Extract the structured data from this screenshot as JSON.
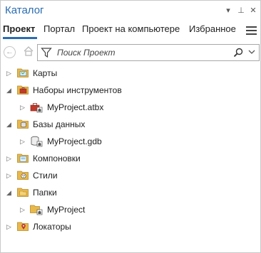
{
  "titlebar": {
    "title": "Каталог",
    "menu_btn": "▾",
    "pin_btn": "⊥",
    "close_btn": "✕"
  },
  "tabs": [
    {
      "label": "Проект"
    },
    {
      "label": "Портал"
    },
    {
      "label": "Проект на компьютере"
    },
    {
      "label": "Избранное"
    }
  ],
  "toolbar": {
    "back_glyph": "←",
    "search_placeholder": "Поиск Проект"
  },
  "tree": {
    "maps": {
      "label": "Карты",
      "expanded": false
    },
    "toolboxes": {
      "label": "Наборы инструментов",
      "expanded": true
    },
    "toolbox_item": {
      "label": "MyProject.atbx"
    },
    "databases": {
      "label": "Базы данных",
      "expanded": true
    },
    "db_item": {
      "label": "MyProject.gdb"
    },
    "layouts": {
      "label": "Компоновки",
      "expanded": false
    },
    "styles": {
      "label": "Стили",
      "expanded": false
    },
    "folders": {
      "label": "Папки",
      "expanded": true
    },
    "folder_item": {
      "label": "MyProject"
    },
    "locators": {
      "label": "Локаторы",
      "expanded": false
    }
  },
  "colors": {
    "accent": "#2b6cb0",
    "folder": "#e8b84a",
    "toolbox_red": "#c0392b"
  }
}
